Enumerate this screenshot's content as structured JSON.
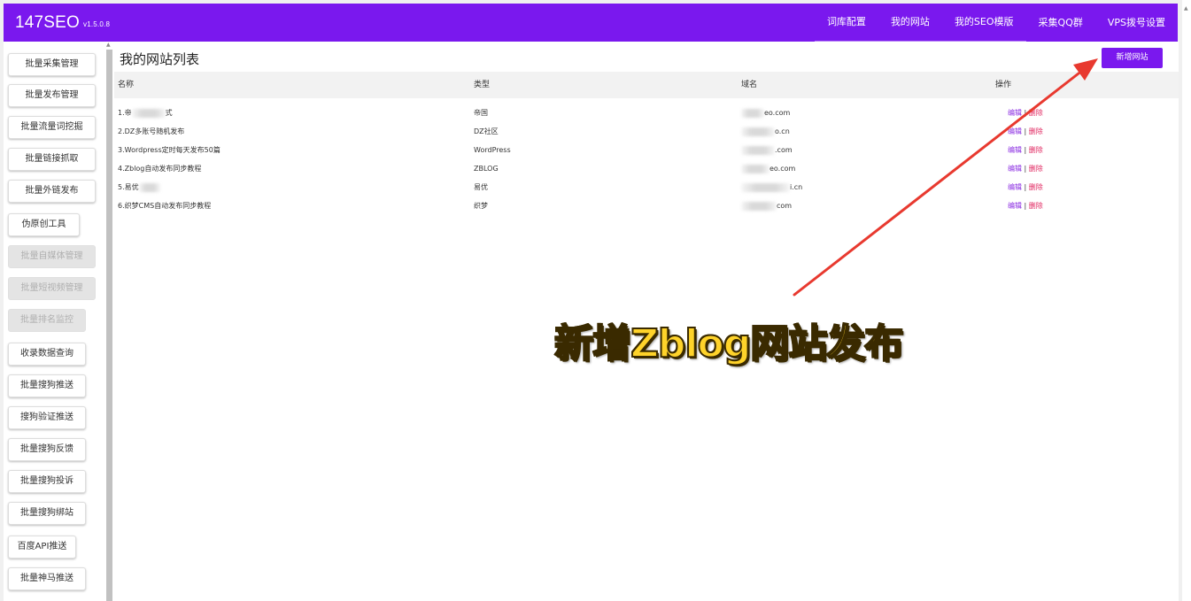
{
  "brand": {
    "name": "147SEO",
    "version": "v1.5.0.8"
  },
  "nav": [
    "词库配置",
    "我的网站",
    "我的SEO模版",
    "采集QQ群",
    "VPS拨号设置"
  ],
  "sidebar": [
    {
      "label": "批量采集管理",
      "disabled": false
    },
    {
      "label": "批量发布管理",
      "disabled": false
    },
    {
      "label": "批量流量词挖掘",
      "disabled": false
    },
    {
      "label": "批量链接抓取",
      "disabled": false
    },
    {
      "label": "批量外链发布",
      "disabled": false
    },
    {
      "label": "伪原创工具",
      "disabled": false
    },
    {
      "label": "批量自媒体管理",
      "disabled": true
    },
    {
      "label": "批量短视频管理",
      "disabled": true
    },
    {
      "label": "批量排名监控",
      "disabled": true
    },
    {
      "label": "收录数据查询",
      "disabled": false
    },
    {
      "label": "批量搜狗推送",
      "disabled": false
    },
    {
      "label": "搜狗验证推送",
      "disabled": false
    },
    {
      "label": "批量搜狗反馈",
      "disabled": false
    },
    {
      "label": "批量搜狗投诉",
      "disabled": false
    },
    {
      "label": "批量搜狗绑站",
      "disabled": false
    },
    {
      "label": "百度API推送",
      "disabled": false
    },
    {
      "label": "批量神马推送",
      "disabled": false
    }
  ],
  "main": {
    "title": "我的网站列表",
    "add_button": "新增网站",
    "columns": [
      "名称",
      "类型",
      "域名",
      "操作"
    ],
    "rows": [
      {
        "name": "1.帝",
        "name_tail": "式",
        "type": "帝国",
        "domain_tail": "eo.com"
      },
      {
        "name": "2.DZ多账号随机发布",
        "name_tail": "",
        "type": "DZ社区",
        "domain_tail": "o.cn"
      },
      {
        "name": "3.Wordpress定时每天发布50篇",
        "name_tail": "",
        "type": "WordPress",
        "domain_tail": ".com"
      },
      {
        "name": "4.Zblog自动发布同步教程",
        "name_tail": "",
        "type": "ZBLOG",
        "domain_tail": "eo.com"
      },
      {
        "name": "5.易优",
        "name_tail": "",
        "type": "易优",
        "domain_tail": "i.cn"
      },
      {
        "name": "6.织梦CMS自动发布同步教程",
        "name_tail": "",
        "type": "织梦",
        "domain_tail": "com"
      }
    ],
    "op_edit": "编辑",
    "op_sep": "|",
    "op_delete": "删除"
  },
  "annotation": {
    "text": "新增Zblog网站发布",
    "color": "#ffd32a",
    "arrow_color": "#e8392f"
  },
  "colors": {
    "brand": "#7a18ee",
    "edit": "#8a2be2",
    "delete": "#e0245e"
  }
}
